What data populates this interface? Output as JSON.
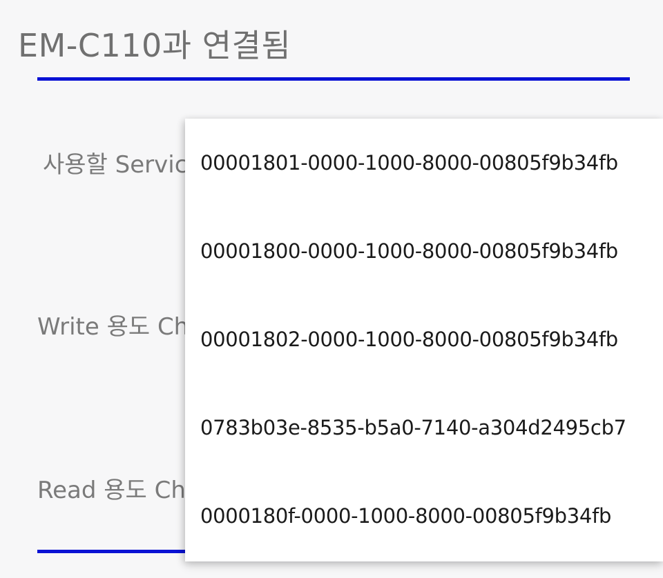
{
  "header": {
    "title": "EM-C110과 연결됨"
  },
  "labels": {
    "service": "사용할 Service",
    "write": "Write 용도 Characteristic",
    "read": "Read 용도 Characteristic"
  },
  "dropdown": {
    "options": [
      "00001801-0000-1000-8000-00805f9b34fb",
      "00001800-0000-1000-8000-00805f9b34fb",
      "00001802-0000-1000-8000-00805f9b34fb",
      "0783b03e-8535-b5a0-7140-a304d2495cb7",
      "0000180f-0000-1000-8000-00805f9b34fb"
    ]
  },
  "colors": {
    "accent": "#0a12d4",
    "background": "#f7f7f8",
    "label_text": "#7a7a7a",
    "option_text": "#1a1a1a"
  }
}
